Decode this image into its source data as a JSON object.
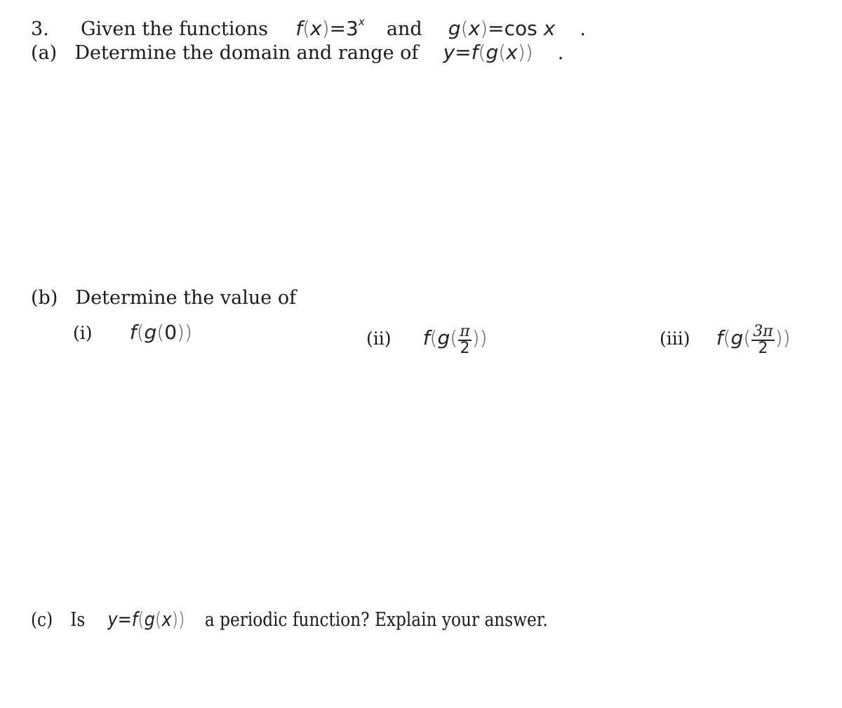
{
  "question": {
    "number": "3.",
    "intro": "Given the functions",
    "f_def": {
      "lhs": "f",
      "var": "x",
      "base": "3",
      "exp": "x"
    },
    "connector": "and",
    "g_def": {
      "lhs": "g",
      "var": "x",
      "rhs_fn": "cos",
      "rhs_var": "x"
    },
    "end": "."
  },
  "part_a": {
    "label": "(a)",
    "text": "Determine the domain and range of",
    "expr": {
      "y": "y",
      "f": "f",
      "g": "g",
      "x": "x"
    },
    "end": "."
  },
  "part_b": {
    "label": "(b)",
    "text": "Determine the value of",
    "items": [
      {
        "label": "(i)",
        "f": "f",
        "g": "g",
        "arg": "0"
      },
      {
        "label": "(ii)",
        "f": "f",
        "g": "g",
        "num": "π",
        "den": "2"
      },
      {
        "label": "(iii)",
        "f": "f",
        "g": "g",
        "num": "3π",
        "den": "2"
      }
    ]
  },
  "part_c": {
    "label": "(c)",
    "pre": "Is",
    "expr": {
      "y": "y",
      "f": "f",
      "g": "g",
      "x": "x"
    },
    "text": "a periodic function? Explain your answer."
  }
}
